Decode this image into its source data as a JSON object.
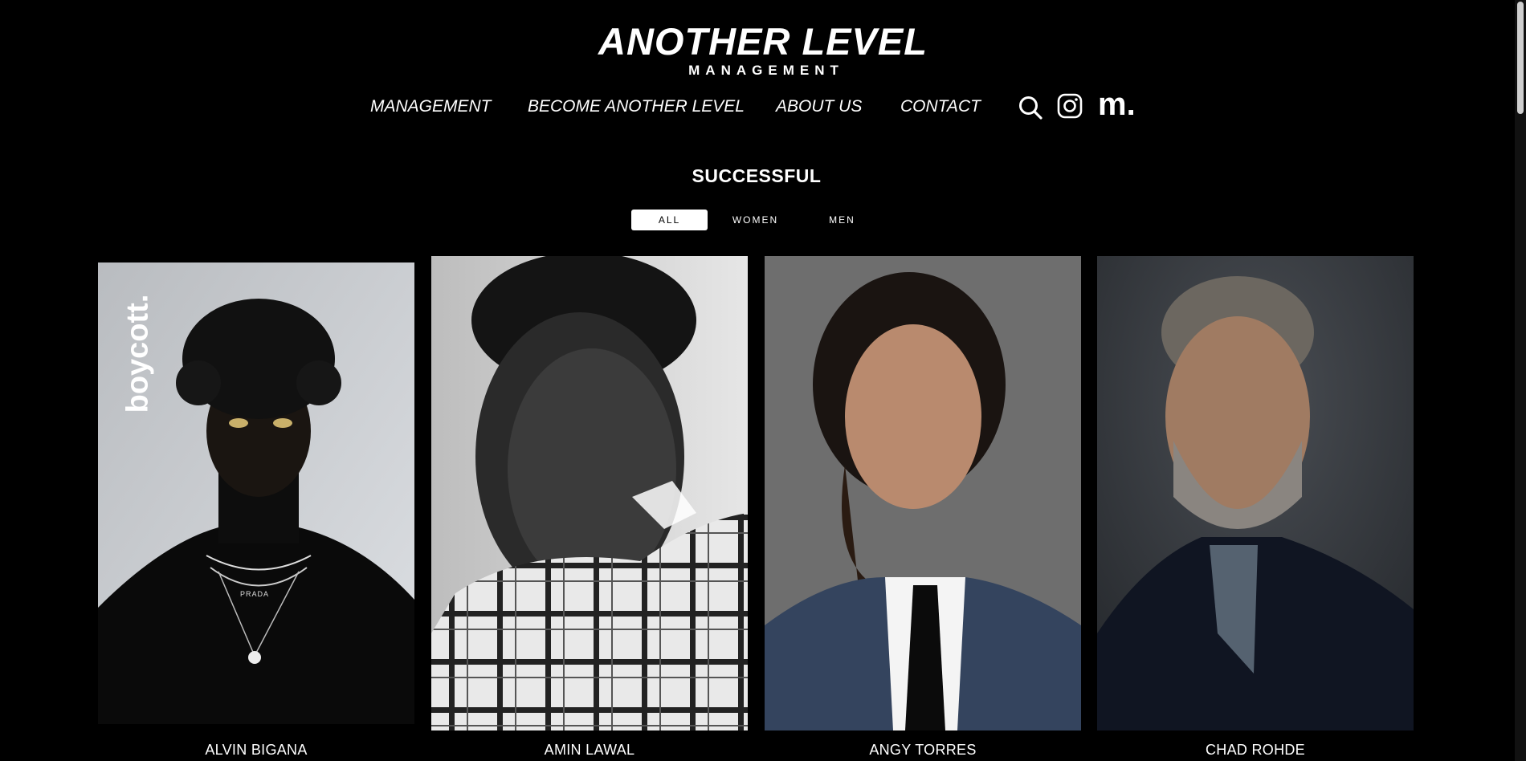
{
  "brand": {
    "name": "ANOTHER LEVEL",
    "subtitle": "MANAGEMENT"
  },
  "nav": {
    "items": [
      "MANAGEMENT",
      "BECOME ANOTHER LEVEL",
      "ABOUT US",
      "CONTACT"
    ],
    "icons": [
      "search-icon",
      "instagram-icon",
      "models-com-icon"
    ],
    "models_mark": "m."
  },
  "section": {
    "title": "SUCCESSFUL"
  },
  "filters": {
    "items": [
      "ALL",
      "WOMEN",
      "MEN"
    ],
    "active": "ALL"
  },
  "models": [
    {
      "name": "ALVIN BIGANA",
      "photo_text": "boycott.",
      "necklace_text": "PRADA"
    },
    {
      "name": "AMIN LAWAL"
    },
    {
      "name": "ANGY TORRES"
    },
    {
      "name": "CHAD ROHDE"
    }
  ]
}
